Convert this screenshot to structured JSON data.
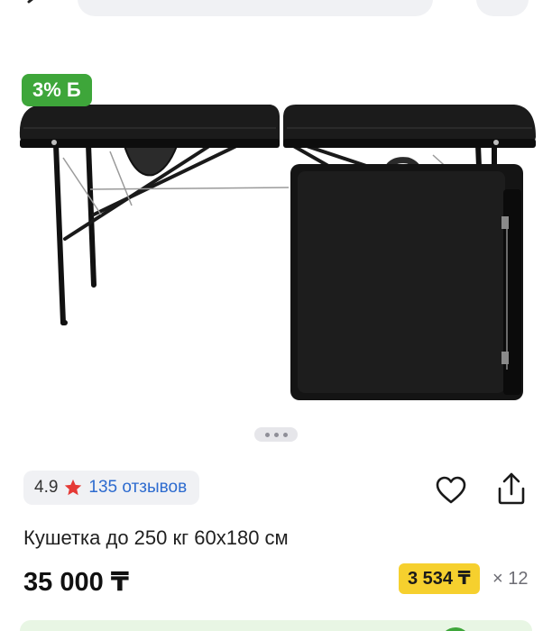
{
  "header": {
    "back_icon": "chevron-left-icon",
    "search_icon": "search-icon",
    "share_icon": "share-icon"
  },
  "gallery": {
    "bonus_badge": "3% Б",
    "image_alt": "massage-table-with-carry-case",
    "slide_count": 3,
    "active_slide": 1
  },
  "rating": {
    "score": "4.9",
    "reviews": "135 отзывов",
    "star_color": "#e53935"
  },
  "product": {
    "title": "Кушетка до 250 кг 60х180 см",
    "price": "35 000 ₸",
    "installment_price": "3 534 ₸",
    "installment_term": "× 12"
  },
  "colors": {
    "accent_green": "#3ea63a",
    "installment_yellow": "#f6d02e",
    "link_blue": "#2d6bcf"
  }
}
